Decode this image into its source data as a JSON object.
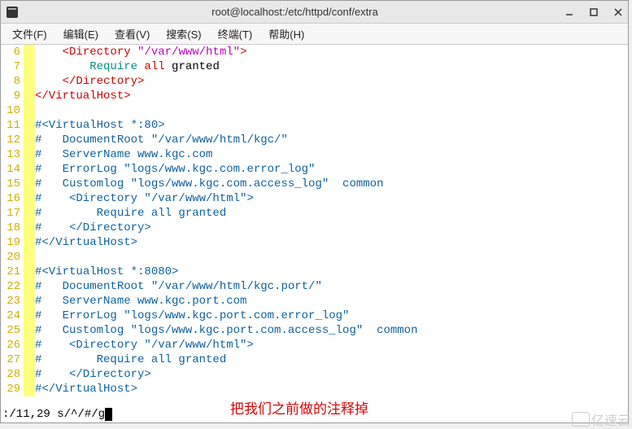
{
  "titlebar": {
    "title": "root@localhost:/etc/httpd/conf/extra"
  },
  "menu": {
    "file": "文件(F)",
    "edit": "编辑(E)",
    "view": "查看(V)",
    "search": "搜索(S)",
    "terminal": "终端(T)",
    "help": "帮助(H)"
  },
  "lines": [
    {
      "n": "6",
      "segs": [
        [
          "    ",
          ""
        ],
        [
          "<Directory ",
          "red"
        ],
        [
          "\"/var/www/html\"",
          "magenta"
        ],
        [
          ">",
          "red"
        ]
      ]
    },
    {
      "n": "7",
      "segs": [
        [
          "        ",
          ""
        ],
        [
          "Require",
          "teal"
        ],
        [
          " all",
          "red"
        ],
        [
          " granted",
          "black"
        ]
      ]
    },
    {
      "n": "8",
      "segs": [
        [
          "    ",
          ""
        ],
        [
          "</Directory>",
          "red"
        ]
      ]
    },
    {
      "n": "9",
      "segs": [
        [
          "",
          ""
        ],
        [
          "</VirtualHost>",
          "red"
        ]
      ]
    },
    {
      "n": "10",
      "segs": []
    },
    {
      "n": "11",
      "segs": [
        [
          "#",
          "blue"
        ],
        [
          "<VirtualHost *:80>",
          "blue"
        ]
      ]
    },
    {
      "n": "12",
      "segs": [
        [
          "#   DocumentRoot \"/var/www/html/kgc/\"",
          "blue"
        ]
      ]
    },
    {
      "n": "13",
      "segs": [
        [
          "#   ServerName www.kgc.com",
          "blue"
        ]
      ]
    },
    {
      "n": "14",
      "segs": [
        [
          "#   ErrorLog \"logs/www.kgc.com.error_log\"",
          "blue"
        ]
      ]
    },
    {
      "n": "15",
      "segs": [
        [
          "#   Customlog \"logs/www.kgc.com.access_log\"  common",
          "blue"
        ]
      ]
    },
    {
      "n": "16",
      "segs": [
        [
          "#    <Directory \"/var/www/html\">",
          "blue"
        ]
      ]
    },
    {
      "n": "17",
      "segs": [
        [
          "#        Require all granted",
          "blue"
        ]
      ]
    },
    {
      "n": "18",
      "segs": [
        [
          "#    </Directory>",
          "blue"
        ]
      ]
    },
    {
      "n": "19",
      "segs": [
        [
          "#",
          "blue"
        ],
        [
          "</VirtualHost>",
          "blue"
        ]
      ]
    },
    {
      "n": "20",
      "segs": []
    },
    {
      "n": "21",
      "segs": [
        [
          "#",
          "blue"
        ],
        [
          "<VirtualHost *:8080>",
          "blue"
        ]
      ]
    },
    {
      "n": "22",
      "segs": [
        [
          "#   DocumentRoot \"/var/www/html/kgc.port/\"",
          "blue"
        ]
      ]
    },
    {
      "n": "23",
      "segs": [
        [
          "#   ServerName www.kgc.port.com",
          "blue"
        ]
      ]
    },
    {
      "n": "24",
      "segs": [
        [
          "#   ErrorLog \"logs/www.kgc.port.com.error_log\"",
          "blue"
        ]
      ]
    },
    {
      "n": "25",
      "segs": [
        [
          "#   Customlog \"logs/www.kgc.port.com.access_log\"  common",
          "blue"
        ]
      ]
    },
    {
      "n": "26",
      "segs": [
        [
          "#    <Directory \"/var/www/html\">",
          "blue"
        ]
      ]
    },
    {
      "n": "27",
      "segs": [
        [
          "#        Require all granted",
          "blue"
        ]
      ]
    },
    {
      "n": "28",
      "segs": [
        [
          "#    </Directory>",
          "blue"
        ]
      ]
    },
    {
      "n": "29",
      "segs": [
        [
          "#",
          "blue"
        ],
        [
          "</VirtualHost>",
          "blue"
        ]
      ]
    }
  ],
  "cmd": ":/11,29 s/^/#/g",
  "annotation": "把我们之前做的注释掉",
  "watermark": "亿速云"
}
